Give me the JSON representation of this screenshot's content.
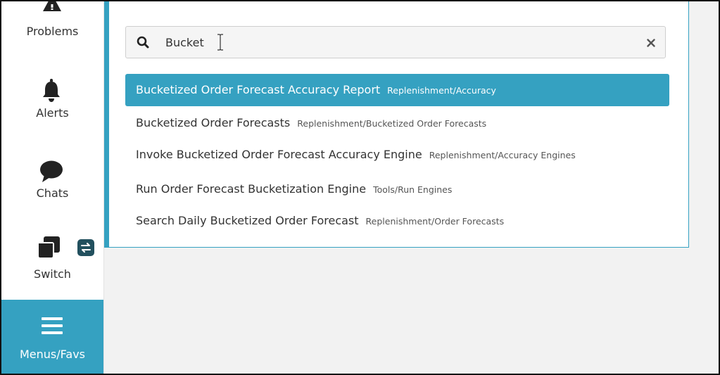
{
  "sidebar": {
    "items": [
      {
        "label": "Problems",
        "icon": "warning-icon"
      },
      {
        "label": "Alerts",
        "icon": "bell-icon"
      },
      {
        "label": "Chats",
        "icon": "chat-bubble-icon"
      },
      {
        "label": "Switch",
        "icon": "windows-icon",
        "badge_icon": "swap-arrows-icon"
      },
      {
        "label": "Menus/Favs",
        "icon": "hamburger-icon",
        "active": true
      }
    ]
  },
  "search": {
    "value": "Bucket",
    "icon": "search-icon",
    "clear_icon": "close-icon"
  },
  "results": [
    {
      "title": "Bucketized Order Forecast Accuracy Report",
      "path": "Replenishment/Accuracy",
      "selected": true
    },
    {
      "title": "Bucketized Order Forecasts",
      "path": "Replenishment/Bucketized Order Forecasts"
    },
    {
      "title": "Invoke Bucketized Order Forecast Accuracy Engine",
      "path": "Replenishment/Accuracy Engines"
    },
    {
      "title": "Run Order Forecast Bucketization Engine",
      "path": "Tools/Run Engines"
    },
    {
      "title": "Search Daily Bucketized Order Forecast",
      "path": "Replenishment/Order Forecasts"
    }
  ],
  "colors": {
    "accent": "#35a1c1",
    "background": "#f2f2f2",
    "text": "#333333"
  }
}
